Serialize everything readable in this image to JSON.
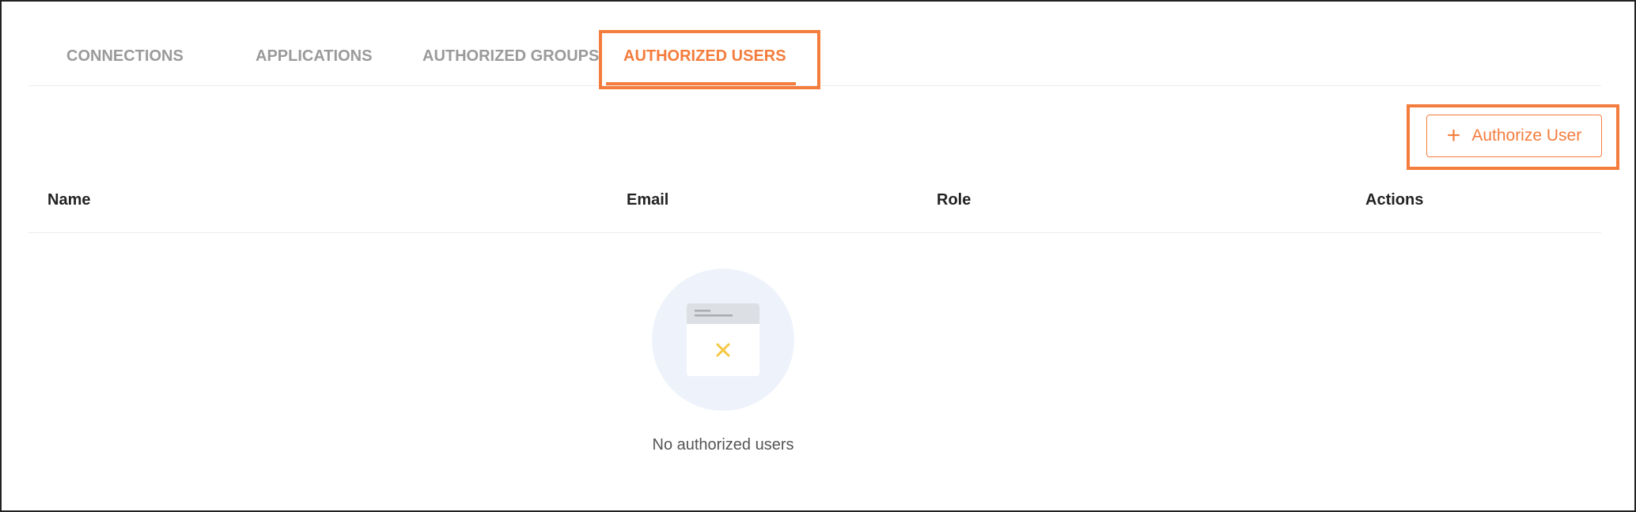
{
  "tabs": [
    {
      "label": "CONNECTIONS",
      "active": false
    },
    {
      "label": "APPLICATIONS",
      "active": false
    },
    {
      "label": "AUTHORIZED GROUPS",
      "active": false
    },
    {
      "label": "AUTHORIZED USERS",
      "active": true
    }
  ],
  "toolbar": {
    "authorize_user_label": "Authorize User",
    "authorize_user_icon": "plus-icon"
  },
  "table": {
    "columns": [
      "Name",
      "Email",
      "Role",
      "Actions"
    ],
    "rows": []
  },
  "empty_state": {
    "message": "No authorized users",
    "icon": "empty-list-icon"
  },
  "colors": {
    "accent": "#f47c3c",
    "tab_inactive": "#9a9a9a",
    "empty_circle": "#eef3fb",
    "empty_mark": "#f5c842"
  }
}
